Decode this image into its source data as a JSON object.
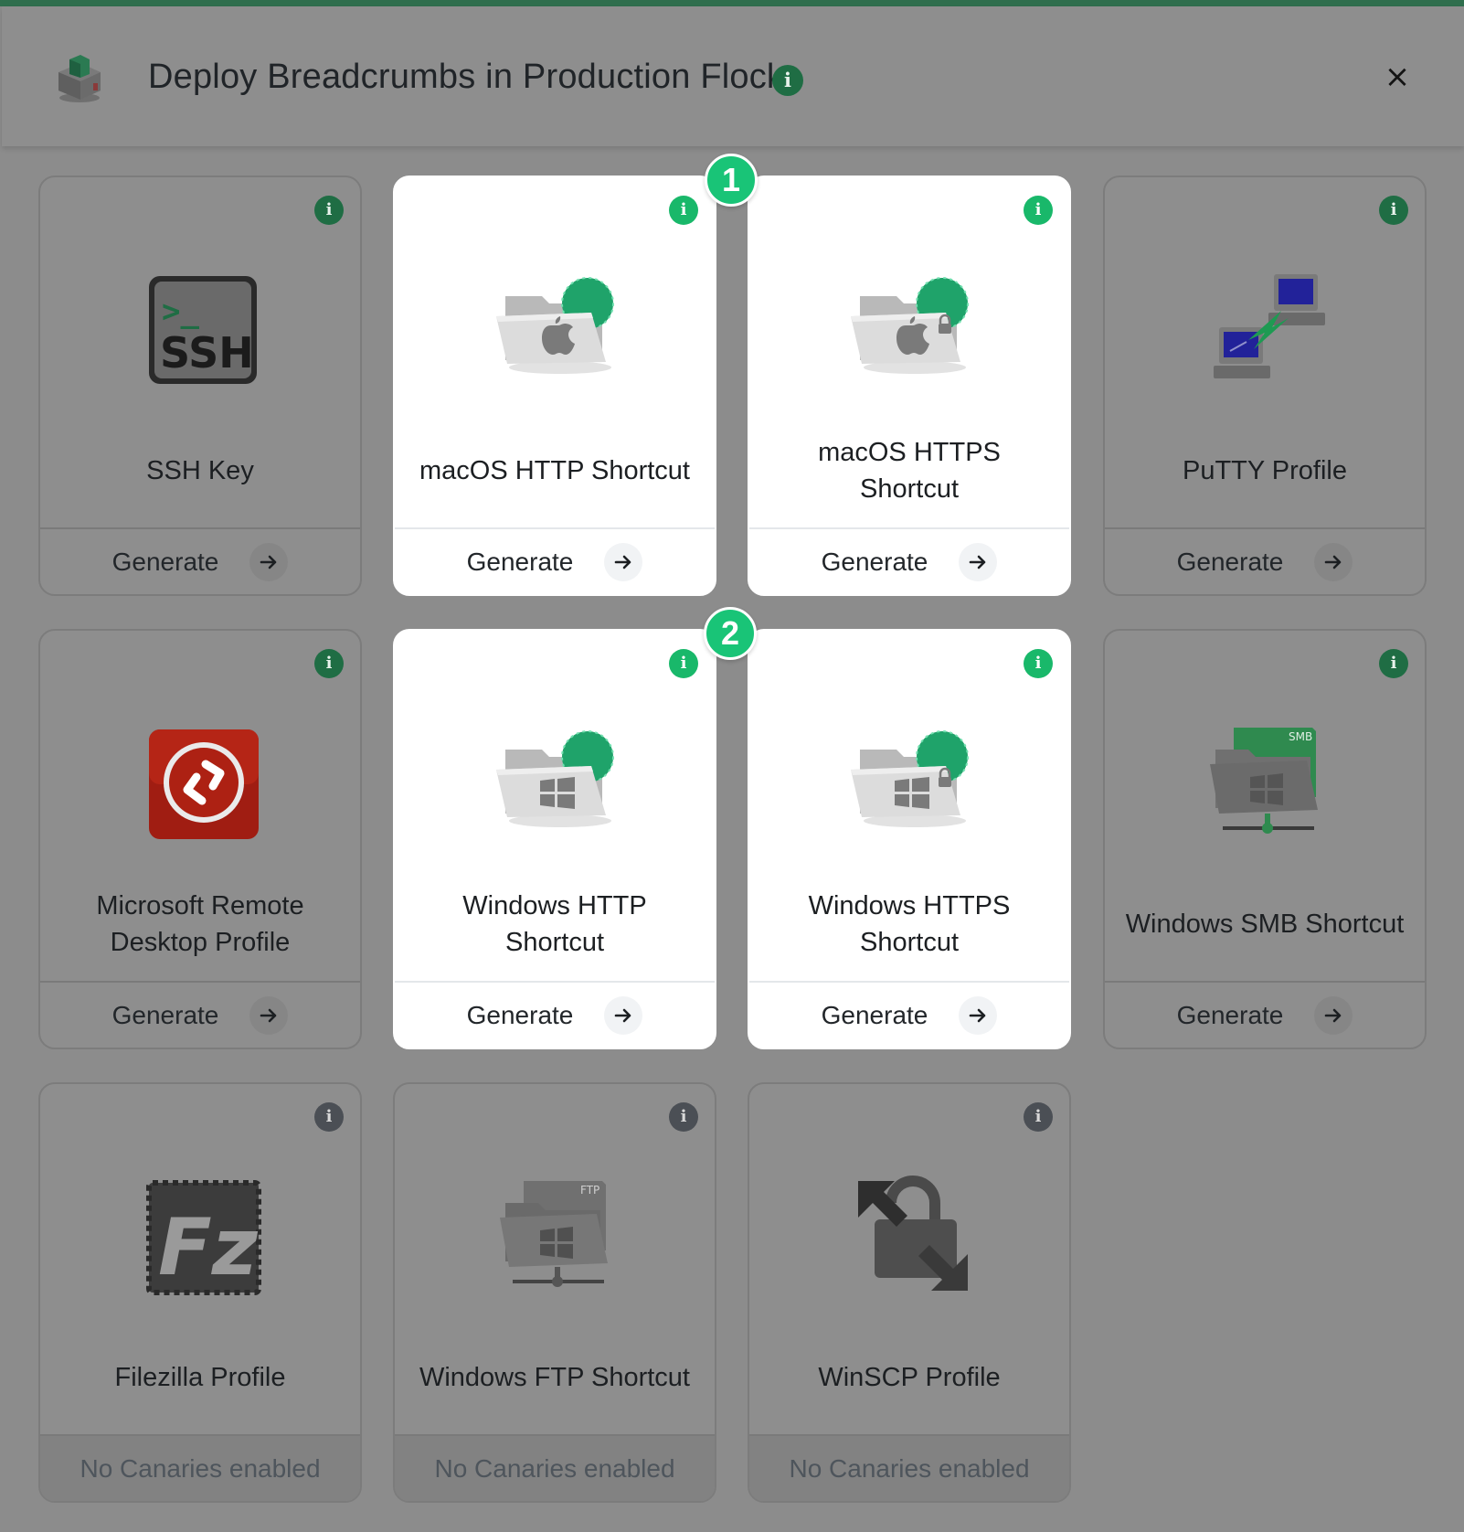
{
  "modal": {
    "title": "Deploy Breadcrumbs in Production Flock",
    "info_glyph": "i",
    "close_glyph": "×",
    "header_icon": "canary-toaster-icon"
  },
  "steps": [
    {
      "label": "1"
    },
    {
      "label": "2"
    }
  ],
  "cards": [
    {
      "name": "SSH Key",
      "footer": "Generate",
      "icon": "ssh-terminal-icon",
      "highlighted": false,
      "enabled": true
    },
    {
      "name": "macOS HTTP Shortcut",
      "footer": "Generate",
      "icon": "macos-network-folder-icon",
      "highlighted": true,
      "enabled": true
    },
    {
      "name": "macOS HTTPS Shortcut",
      "footer": "Generate",
      "icon": "macos-secure-network-folder-icon",
      "highlighted": true,
      "enabled": true
    },
    {
      "name": "PuTTY Profile",
      "footer": "Generate",
      "icon": "putty-computers-icon",
      "highlighted": false,
      "enabled": true
    },
    {
      "name": "Microsoft Remote Desktop Profile",
      "footer": "Generate",
      "icon": "remote-desktop-icon",
      "highlighted": false,
      "enabled": true
    },
    {
      "name": "Windows HTTP Shortcut",
      "footer": "Generate",
      "icon": "windows-network-folder-icon",
      "highlighted": true,
      "enabled": true
    },
    {
      "name": "Windows HTTPS Shortcut",
      "footer": "Generate",
      "icon": "windows-secure-network-folder-icon",
      "highlighted": true,
      "enabled": true
    },
    {
      "name": "Windows SMB Shortcut",
      "footer": "Generate",
      "icon": "smb-share-folder-icon",
      "highlighted": false,
      "enabled": true
    },
    {
      "name": "Filezilla Profile",
      "footer": "No Canaries enabled",
      "icon": "filezilla-icon",
      "highlighted": false,
      "enabled": false
    },
    {
      "name": "Windows FTP Shortcut",
      "footer": "No Canaries enabled",
      "icon": "ftp-share-folder-icon",
      "highlighted": false,
      "enabled": false
    },
    {
      "name": "WinSCP Profile",
      "footer": "No Canaries enabled",
      "icon": "winscp-lock-icon",
      "highlighted": false,
      "enabled": false
    }
  ],
  "icon_labels": {
    "ssh_prompt": ">_",
    "ssh_text": "SSH",
    "smb_tag": "SMB",
    "ftp_tag": "FTP",
    "filezilla_text": "Fz"
  },
  "colors": {
    "brand_green": "#1f6d44",
    "step_green": "#19c477",
    "info_green_active": "#19b86a",
    "info_disabled": "#4b4f55",
    "overlay_gray": "#8c8c8c"
  }
}
